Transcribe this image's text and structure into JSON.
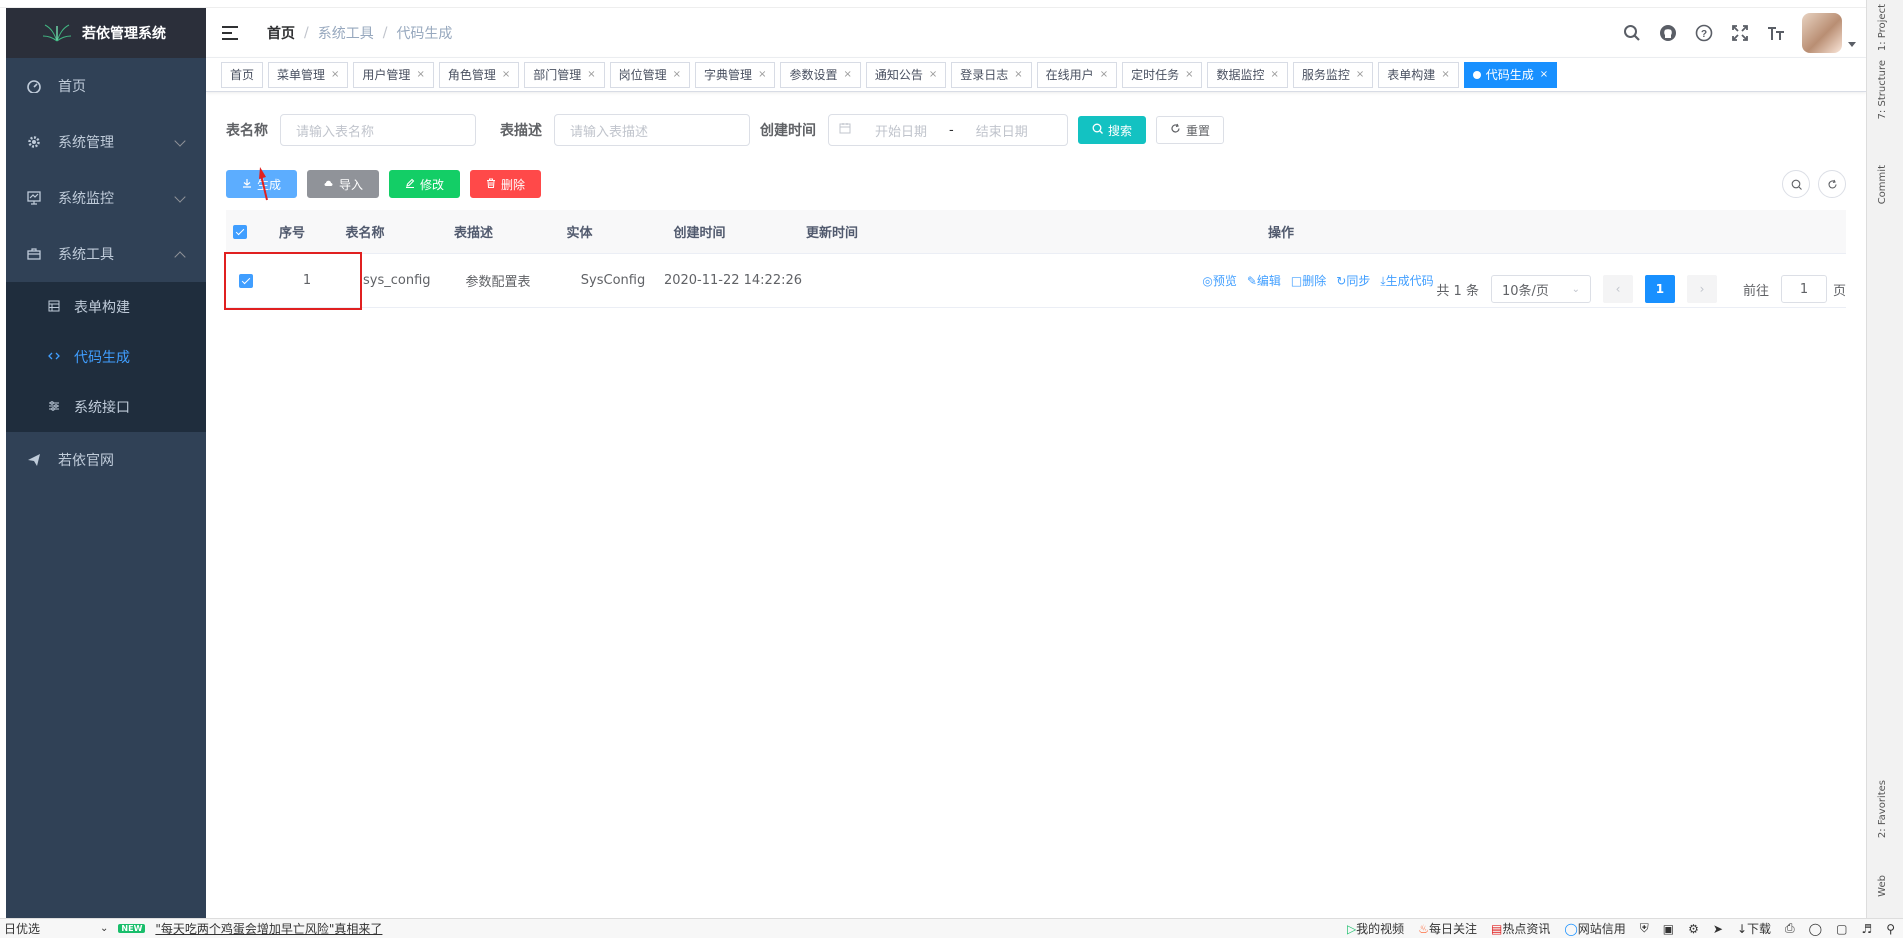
{
  "app": {
    "title": "若依管理系统"
  },
  "sidebar": {
    "items": [
      {
        "label": "首页",
        "icon": "dashboard-icon"
      },
      {
        "label": "系统管理",
        "icon": "gear-icon"
      },
      {
        "label": "系统监控",
        "icon": "monitor-icon"
      },
      {
        "label": "系统工具",
        "icon": "toolbox-icon"
      }
    ],
    "sub": [
      {
        "label": "表单构建",
        "icon": "form-icon"
      },
      {
        "label": "代码生成",
        "icon": "code-icon"
      },
      {
        "label": "系统接口",
        "icon": "api-icon"
      }
    ],
    "extra": {
      "label": "若依官网",
      "icon": "send-icon"
    }
  },
  "breadcrumb": [
    "首页",
    "系统工具",
    "代码生成"
  ],
  "tags": [
    {
      "label": "首页",
      "closable": false
    },
    {
      "label": "菜单管理",
      "closable": true
    },
    {
      "label": "用户管理",
      "closable": true
    },
    {
      "label": "角色管理",
      "closable": true
    },
    {
      "label": "部门管理",
      "closable": true
    },
    {
      "label": "岗位管理",
      "closable": true
    },
    {
      "label": "字典管理",
      "closable": true
    },
    {
      "label": "参数设置",
      "closable": true
    },
    {
      "label": "通知公告",
      "closable": true
    },
    {
      "label": "登录日志",
      "closable": true
    },
    {
      "label": "在线用户",
      "closable": true
    },
    {
      "label": "定时任务",
      "closable": true
    },
    {
      "label": "数据监控",
      "closable": true
    },
    {
      "label": "服务监控",
      "closable": true
    },
    {
      "label": "表单构建",
      "closable": true
    },
    {
      "label": "代码生成",
      "closable": true,
      "active": true
    }
  ],
  "search": {
    "table_name_label": "表名称",
    "table_name_placeholder": "请输入表名称",
    "table_desc_label": "表描述",
    "table_desc_placeholder": "请输入表描述",
    "date_label": "创建时间",
    "date_start": "开始日期",
    "date_sep": "-",
    "date_end": "结束日期",
    "search_btn": "搜索",
    "reset_btn": "重置"
  },
  "toolbar": {
    "generate": "生成",
    "import": "导入",
    "edit": "修改",
    "delete": "删除"
  },
  "table": {
    "columns": [
      "序号",
      "表名称",
      "表描述",
      "实体",
      "创建时间",
      "更新时间",
      "操作"
    ],
    "rows": [
      {
        "index": "1",
        "name": "sys_config",
        "desc": "参数配置表",
        "entity": "SysConfig",
        "created": "2020-11-22 14:22:26",
        "updated": ""
      }
    ],
    "ops": [
      "预览",
      "编辑",
      "删除",
      "同步",
      "生成代码"
    ]
  },
  "pager": {
    "total": "共 1 条",
    "size": "10条/页",
    "current": "1",
    "goto_label": "前往",
    "goto_value": "1",
    "page_suffix": "页"
  },
  "ide": {
    "labels": [
      "1: Project",
      "7: Structure",
      "Commit",
      "2: Favorites",
      "Web"
    ]
  },
  "statusbar": {
    "left_text": "日优选",
    "news_badge": "NEW",
    "news": "\"每天吃两个鸡蛋会增加早亡风险\"真相来了",
    "right": [
      "我的视频",
      "每日关注",
      "热点资讯",
      "网站信用",
      "下载"
    ]
  },
  "colors": {
    "sidebar_bg": "#304156",
    "active": "#409eff",
    "tag_active": "#1890ff"
  }
}
